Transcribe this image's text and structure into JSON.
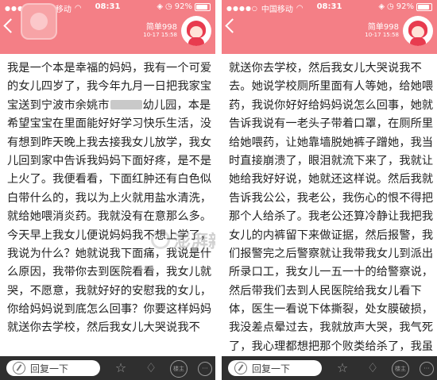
{
  "colors": {
    "header_bg": "#f47f86",
    "bottom_bar_bg": "#2f2f2f",
    "text": "#222222"
  },
  "status": {
    "carrier": "中国移动",
    "time": "08:31",
    "battery": "92%"
  },
  "post": {
    "username": "简单998",
    "time": "10-17 15:58"
  },
  "icons": {
    "back": "chevron-left-icon",
    "avatar": "girl-avatar",
    "reply": "pen-icon",
    "star": "star-icon",
    "bulb": "lightbulb-icon",
    "owner": "owner-icon",
    "more": "more-icon"
  },
  "watermark": "澎湃新闻",
  "bottom": {
    "reply_placeholder": "回复一下",
    "owner_label": "楼主",
    "more_label": "···"
  },
  "left_lines": [
    "我是一个本是幸福的妈妈，我有一个可爱",
    "的女儿四岁了，我今年九月一日把我家宝",
    "宝送到宁波市余姚市",
    "幼儿园，本是",
    "希望宝宝在里面能好好学习快乐生活，没",
    "有想到昨天晚上我去接我女儿放学，我女",
    "儿回到家中告诉我妈妈下面好疼，是不是",
    "上火了。我便看看，下面红肿还有白色似",
    "白带什么的，我以为上火就用盐水清洗，",
    "就给她喂消炎药。我就没有在意那么多。",
    "今天早上我女儿便说妈妈我不想上学了，",
    "我说为什么？她就说我下面痛，我说是什",
    "么原因，我带你去到医院看看，我女儿就",
    "哭，不愿意，我就好好的安慰我的女儿，",
    "你给妈妈说到底怎么回事？你要这样妈妈",
    "就送你去学校，然后我女儿大哭说我不"
  ],
  "right_lines": [
    "就送你去学校，然后我女儿大哭说我不",
    "去。她说学校厕所里面有人等她，给她喂",
    "药，我说你好好给妈妈说怎么回事，她就",
    "告诉我说有一老头子带着口罩，在厕所里面",
    "给她喂药，让她靠墙脱她裤子蹭她，我当",
    "时直接崩溃了，眼泪就流下来了，我就让",
    "她给我好好说，她就还这样说。然后我就",
    "告诉我公公，我老公，我伤心的恨不得把",
    "那个人给杀了。我老公还算冷静让我把我",
    "女儿的内裤留下来做证据，然后报警，我",
    "们报警完之后警察就让我带我女儿到派出",
    "所录口工，我女儿一五一十的给警察说，",
    "然后带我们去到人民医院给我女儿看下",
    "体，医生一看说下体撕裂，处女膜破损，",
    "我没差点晕过去，我就放声大哭，我气死",
    "了，我心理都想把那个败类给杀了，我虽"
  ]
}
